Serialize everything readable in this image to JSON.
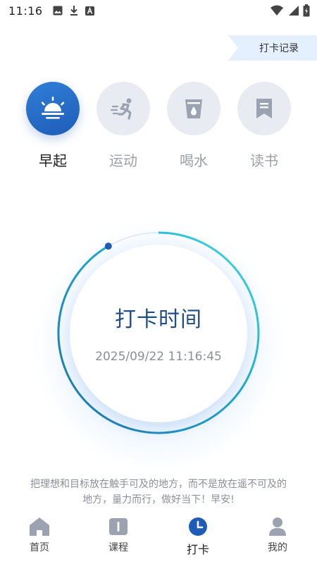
{
  "status_bar": {
    "time": "11:16"
  },
  "header": {
    "record_label": "打卡记录"
  },
  "categories": [
    {
      "label": "早起",
      "icon": "sunrise-icon",
      "active": true
    },
    {
      "label": "运动",
      "icon": "running-icon",
      "active": false
    },
    {
      "label": "喝水",
      "icon": "water-cup-icon",
      "active": false
    },
    {
      "label": "读书",
      "icon": "bookmark-icon",
      "active": false
    }
  ],
  "checkin": {
    "title": "打卡时间",
    "datetime": "2025/09/22 11:16:45"
  },
  "motto": "把理想和目标放在触手可及的地方，而不是放在遥不可及的地方，量力而行，做好当下！早安!",
  "nav": [
    {
      "label": "首页",
      "icon": "home-icon"
    },
    {
      "label": "课程",
      "icon": "course-icon"
    },
    {
      "label": "打卡",
      "icon": "clock-icon"
    },
    {
      "label": "我的",
      "icon": "profile-icon"
    }
  ],
  "colors": {
    "accent": "#1e5cb8",
    "ring_start": "#1a7fb0",
    "ring_end": "#3dd6e0",
    "icon_gray": "#9ba3b2"
  }
}
